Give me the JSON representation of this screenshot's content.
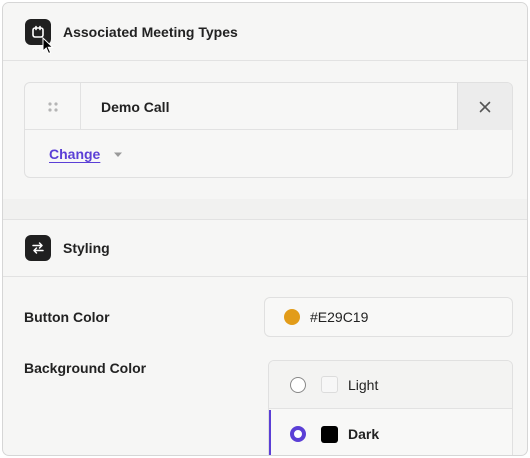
{
  "meeting_types_section": {
    "title": "Associated Meeting Types",
    "icon": "calendar-icon",
    "items": [
      {
        "name": "Demo Call"
      }
    ],
    "change_label": "Change"
  },
  "styling_section": {
    "title": "Styling",
    "icon": "swap-arrows-icon",
    "button_color": {
      "label": "Button Color",
      "value": "#E29C19",
      "swatch": "#E29C19"
    },
    "background_color": {
      "label": "Background Color",
      "options": [
        {
          "label": "Light",
          "swatch": "#f7f7f7",
          "selected": false
        },
        {
          "label": "Dark",
          "swatch": "#000000",
          "selected": true
        }
      ]
    }
  },
  "colors": {
    "accent": "#5b3fd6",
    "header_icon_bg": "#202020"
  }
}
